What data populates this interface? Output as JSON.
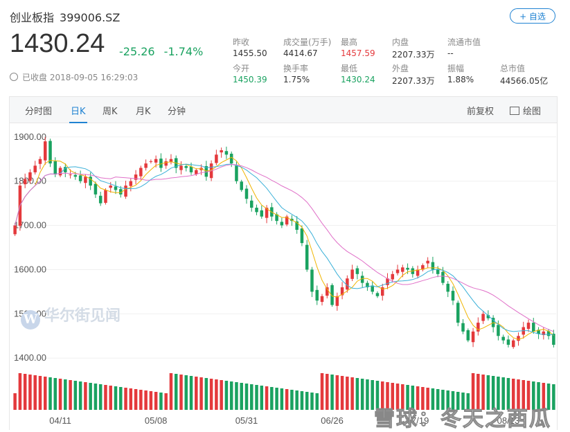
{
  "header": {
    "name": "创业板指",
    "code": "399006.SZ",
    "follow_label": "+ 自选",
    "price": "1430.24",
    "change": "-25.26",
    "change_pct": "-1.74%",
    "status_time": "已收盘 2018-09-05 16:29:03"
  },
  "stats": [
    {
      "label": "昨收",
      "value": "1455.50",
      "color": "normal"
    },
    {
      "label": "成交量(万手)",
      "value": "4414.67",
      "color": "normal"
    },
    {
      "label": "最高",
      "value": "1457.59",
      "color": "red"
    },
    {
      "label": "内盘",
      "value": "2207.33万",
      "color": "normal"
    },
    {
      "label": "流通市值",
      "value": "--",
      "color": "normal"
    },
    {
      "label": "今开",
      "value": "1450.39",
      "color": "green"
    },
    {
      "label": "换手率",
      "value": "1.75%",
      "color": "normal"
    },
    {
      "label": "最低",
      "value": "1430.24",
      "color": "green"
    },
    {
      "label": "外盘",
      "value": "2207.33万",
      "color": "normal"
    },
    {
      "label": "振幅",
      "value": "1.88%",
      "color": "normal"
    },
    {
      "label": "总市值",
      "value": "44566.05亿",
      "color": "normal"
    }
  ],
  "tabs": [
    "分时图",
    "日K",
    "周K",
    "月K",
    "分钟"
  ],
  "active_tab": "日K",
  "tools": {
    "adjust": "前复权",
    "draw": "绘图"
  },
  "watermark": "华尔街见闻",
  "watermark2": "雪球：冬天之西瓜",
  "colors": {
    "up": "#e4393c",
    "down": "#1aa260",
    "ma5": "#f0b400",
    "ma10": "#3ab0d8",
    "ma20": "#e070c8",
    "accent": "#1f82d2"
  },
  "chart_data": {
    "type": "candlestick",
    "y_ticks": [
      "1900.00",
      "1800.00",
      "1700.00",
      "1600.00",
      "1500.00",
      "1400.00"
    ],
    "ylim": [
      1380,
      1920
    ],
    "x_tick_labels": [
      {
        "label": "04/11",
        "index": 9
      },
      {
        "label": "05/08",
        "index": 28
      },
      {
        "label": "05/31",
        "index": 46
      },
      {
        "label": "06/26",
        "index": 63
      },
      {
        "label": "07/19",
        "index": 80
      },
      {
        "label": "08/13",
        "index": 98
      }
    ],
    "closes": [
      1700,
      1790,
      1805,
      1820,
      1835,
      1850,
      1890,
      1840,
      1815,
      1830,
      1820,
      1815,
      1810,
      1800,
      1810,
      1790,
      1770,
      1750,
      1780,
      1790,
      1780,
      1770,
      1790,
      1800,
      1815,
      1830,
      1840,
      1845,
      1850,
      1830,
      1845,
      1850,
      1830,
      1835,
      1830,
      1820,
      1825,
      1830,
      1810,
      1840,
      1860,
      1870,
      1860,
      1840,
      1800,
      1780,
      1760,
      1740,
      1730,
      1720,
      1740,
      1720,
      1710,
      1700,
      1720,
      1710,
      1690,
      1660,
      1600,
      1550,
      1530,
      1540,
      1560,
      1520,
      1540,
      1560,
      1580,
      1600,
      1590,
      1570,
      1560,
      1550,
      1540,
      1560,
      1580,
      1590,
      1600,
      1605,
      1600,
      1590,
      1600,
      1610,
      1620,
      1600,
      1590,
      1570,
      1550,
      1530,
      1480,
      1460,
      1440,
      1460,
      1480,
      1500,
      1490,
      1470,
      1450,
      1440,
      1430,
      1440,
      1450,
      1470,
      1480,
      1460,
      1455,
      1460,
      1450,
      1430
    ]
  }
}
